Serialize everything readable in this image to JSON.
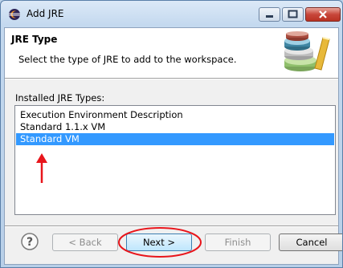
{
  "window": {
    "title": "Add JRE",
    "icon": "eclipse-icon",
    "controls": [
      "minimize-icon",
      "maximize-icon",
      "close-icon"
    ]
  },
  "banner": {
    "title": "JRE Type",
    "description": "Select the type of JRE to add to the workspace.",
    "image": "books-library-icon"
  },
  "list": {
    "label": "Installed JRE Types:",
    "items": [
      {
        "label": "Execution Environment Description",
        "selected": false
      },
      {
        "label": "Standard 1.1.x VM",
        "selected": false
      },
      {
        "label": "Standard VM",
        "selected": true
      }
    ]
  },
  "buttons": {
    "help_icon": "help-question-icon",
    "back": "< Back",
    "next": "Next >",
    "finish": "Finish",
    "cancel": "Cancel"
  },
  "annotations": {
    "arrow_color": "#e8151b",
    "ellipse_color": "#e8151b"
  },
  "colors": {
    "selection": "#3399ff",
    "window_frame": "#c4d9ef"
  }
}
